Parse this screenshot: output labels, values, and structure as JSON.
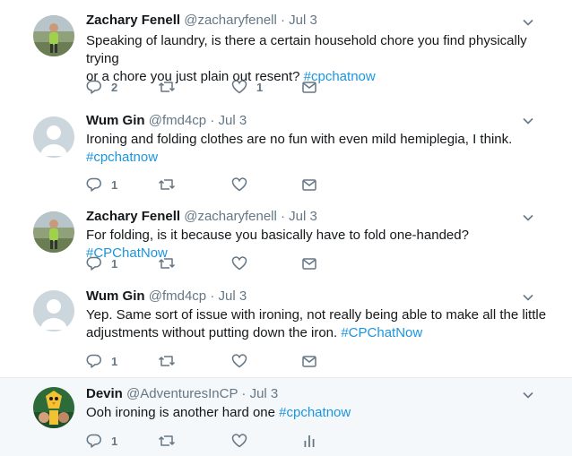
{
  "tweets": [
    {
      "name": "Zachary Fenell",
      "handle": "@zacharyfenell",
      "dot": "·",
      "date": "Jul 3",
      "text_line1": "Speaking of laundry, is there a certain household chore you find physically trying",
      "text_line2": "or a chore you just plain out resent? ",
      "tag": "#cpchatnow",
      "reply_count": "2",
      "like_count": "1",
      "avatar": "zachary-avatar"
    },
    {
      "name": "Wum Gin",
      "handle": "@fmd4cp",
      "dot": "·",
      "date": "Jul 3",
      "text_line1": "Ironing and folding clothes are no fun with even mild hemiplegia, I think.",
      "tag": "#cpchatnow",
      "reply_count": "1",
      "avatar": "default-egg-avatar"
    },
    {
      "name": "Zachary Fenell",
      "handle": "@zacharyfenell",
      "dot": "·",
      "date": "Jul 3",
      "text_line1": "For folding, is it because you basically have to fold one-handed? ",
      "tag": "#CPChatNow",
      "reply_count": "1",
      "avatar": "zachary-avatar"
    },
    {
      "name": "Wum Gin",
      "handle": "@fmd4cp",
      "dot": "·",
      "date": "Jul 3",
      "text_line1": "Yep. Same sort of issue with ironing, not really being able to make all the little",
      "text_line2": "adjustments without putting down the iron. ",
      "tag": "#CPChatNow",
      "reply_count": "1",
      "avatar": "default-egg-avatar"
    },
    {
      "name": "Devin",
      "handle": "@AdventuresInCP",
      "dot": "·",
      "date": "Jul 3",
      "text_line1": "Ooh ironing is another hard one ",
      "tag": "#cpchatnow",
      "reply_count": "1",
      "avatar": "devin-avatar"
    }
  ],
  "colors": {
    "link": "#1b95e0",
    "muted": "#657786",
    "thread_line": "#a3d0f3",
    "highlight_bg": "#f5f8fa"
  },
  "icons": [
    "reply-icon",
    "retweet-icon",
    "like-icon",
    "direct-message-icon",
    "analytics-icon",
    "caret-down-icon"
  ]
}
